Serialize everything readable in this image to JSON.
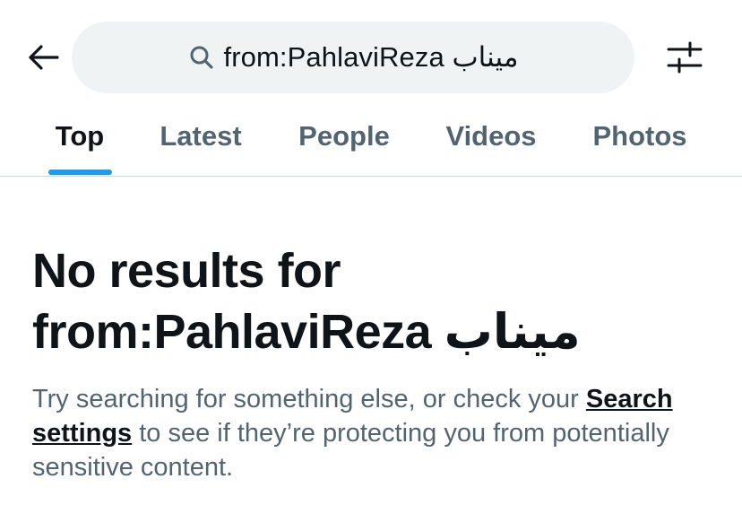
{
  "header": {
    "back_icon": "arrow-left-icon",
    "search_icon": "search-icon",
    "search_query": "from:PahlaviReza ميناب",
    "filter_icon": "sliders-icon"
  },
  "tabs": [
    {
      "label": "Top",
      "active": true
    },
    {
      "label": "Latest",
      "active": false
    },
    {
      "label": "People",
      "active": false
    },
    {
      "label": "Videos",
      "active": false
    },
    {
      "label": "Photos",
      "active": false
    }
  ],
  "empty_state": {
    "title_line1": "No results for",
    "title_line2": "from:PahlaviReza ميناب",
    "message_part1": "Try searching for something else, or check your ",
    "link_label": "Search settings",
    "message_part2": " to see if they’re protecting you from potentially sensitive content."
  },
  "colors": {
    "accent": "#1d9bf0",
    "text_primary": "#0f1419",
    "text_secondary": "#536471",
    "search_bg": "#eff3f4",
    "divider": "#cfd9de"
  }
}
